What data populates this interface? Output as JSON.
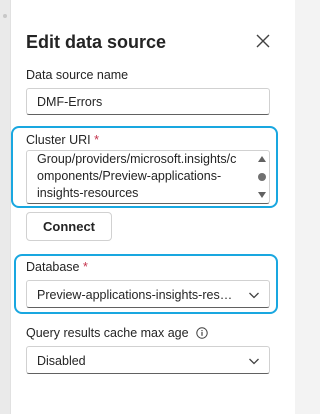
{
  "panel": {
    "title": "Edit data source",
    "close_icon": "close-icon"
  },
  "fields": {
    "data_source_name": {
      "label": "Data source name",
      "value": "DMF-Errors"
    },
    "cluster_uri": {
      "label": "Cluster URI",
      "required_mark": "*",
      "lines": [
        "Group/providers/microsoft.insights/c",
        "omponents/Preview-applications-",
        "insights-resources"
      ]
    },
    "connect_button": "Connect",
    "database": {
      "label": "Database",
      "required_mark": "*",
      "selected": "Preview-applications-insights-reso..."
    },
    "cache_max_age": {
      "label": "Query results cache max age",
      "info_icon": "info-icon",
      "selected": "Disabled"
    }
  },
  "colors": {
    "highlight": "#19a7e0",
    "required": "#c4314b"
  }
}
